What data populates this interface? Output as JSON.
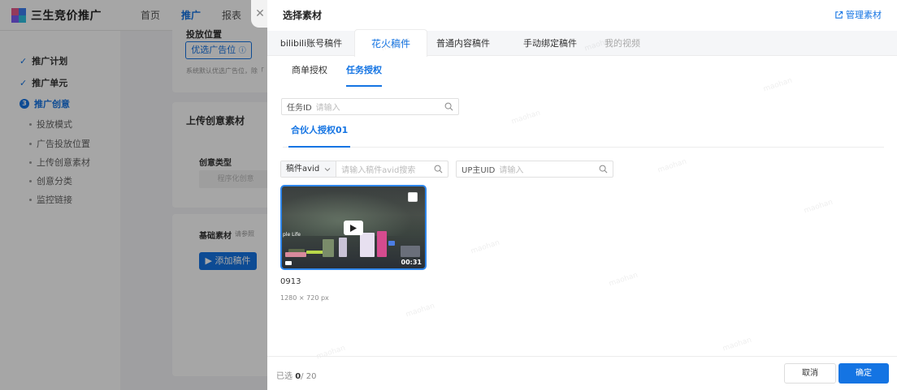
{
  "app": {
    "logo_text": "三生竞价推广",
    "nav": [
      "首页",
      "推广",
      "报表"
    ],
    "active_nav_index": 1
  },
  "sidebar": {
    "steps": [
      {
        "label": "推广计划",
        "state": "done"
      },
      {
        "label": "推广单元",
        "state": "done"
      },
      {
        "label": "推广创意",
        "state": "active",
        "number": "3"
      }
    ],
    "sub_items": [
      "投放模式",
      "广告投放位置",
      "上传创意素材",
      "创意分类",
      "监控链接"
    ]
  },
  "background": {
    "placement_title": "投放位置",
    "preferred_btn": "优选广告位",
    "placement_hint": "系统默认优选广告位，除「",
    "upload_title": "上传创意素材",
    "creative_type_label": "创意类型",
    "creative_type_value": "程序化创意",
    "basic_material_label": "基础素材",
    "basic_material_hint": "请参照",
    "add_draft_btn": "添加稿件"
  },
  "drawer": {
    "title": "选择素材",
    "manage_link": "管理素材",
    "tabs": [
      {
        "label": "bilibili账号稿件",
        "state": "normal"
      },
      {
        "label": "花火稿件",
        "state": "active"
      },
      {
        "label": "普通内容稿件",
        "state": "normal"
      },
      {
        "label": "手动绑定稿件",
        "state": "normal"
      },
      {
        "label": "我的视频",
        "state": "disabled"
      }
    ],
    "subtabs": [
      {
        "label": "商单授权",
        "state": "normal"
      },
      {
        "label": "任务授权",
        "state": "active"
      }
    ],
    "task_search": {
      "label": "任务ID",
      "placeholder": "请输入"
    },
    "partner_tab": "合伙人授权01",
    "filter_avid": {
      "select_value": "稿件avid",
      "placeholder": "请输入稿件avid搜索"
    },
    "filter_up": {
      "label": "UP主UID",
      "placeholder": "请输入"
    },
    "materials": [
      {
        "name": "0913",
        "size": "1280 × 720 px",
        "duration": "00:31",
        "overlay_text": "ple Life"
      }
    ],
    "footer": {
      "selected_prefix": "已选 ",
      "selected_current": "0",
      "selected_total": "/ 20",
      "cancel": "取消",
      "confirm": "确定"
    },
    "watermark": "maohan"
  },
  "colors": {
    "accent": "#1474e3",
    "overlay": "rgba(0,0,0,0.35)"
  },
  "icons": [
    "close-icon",
    "external-link-icon",
    "search-icon",
    "chevron-down-icon",
    "play-icon",
    "video-icon",
    "check-icon",
    "info-icon"
  ]
}
